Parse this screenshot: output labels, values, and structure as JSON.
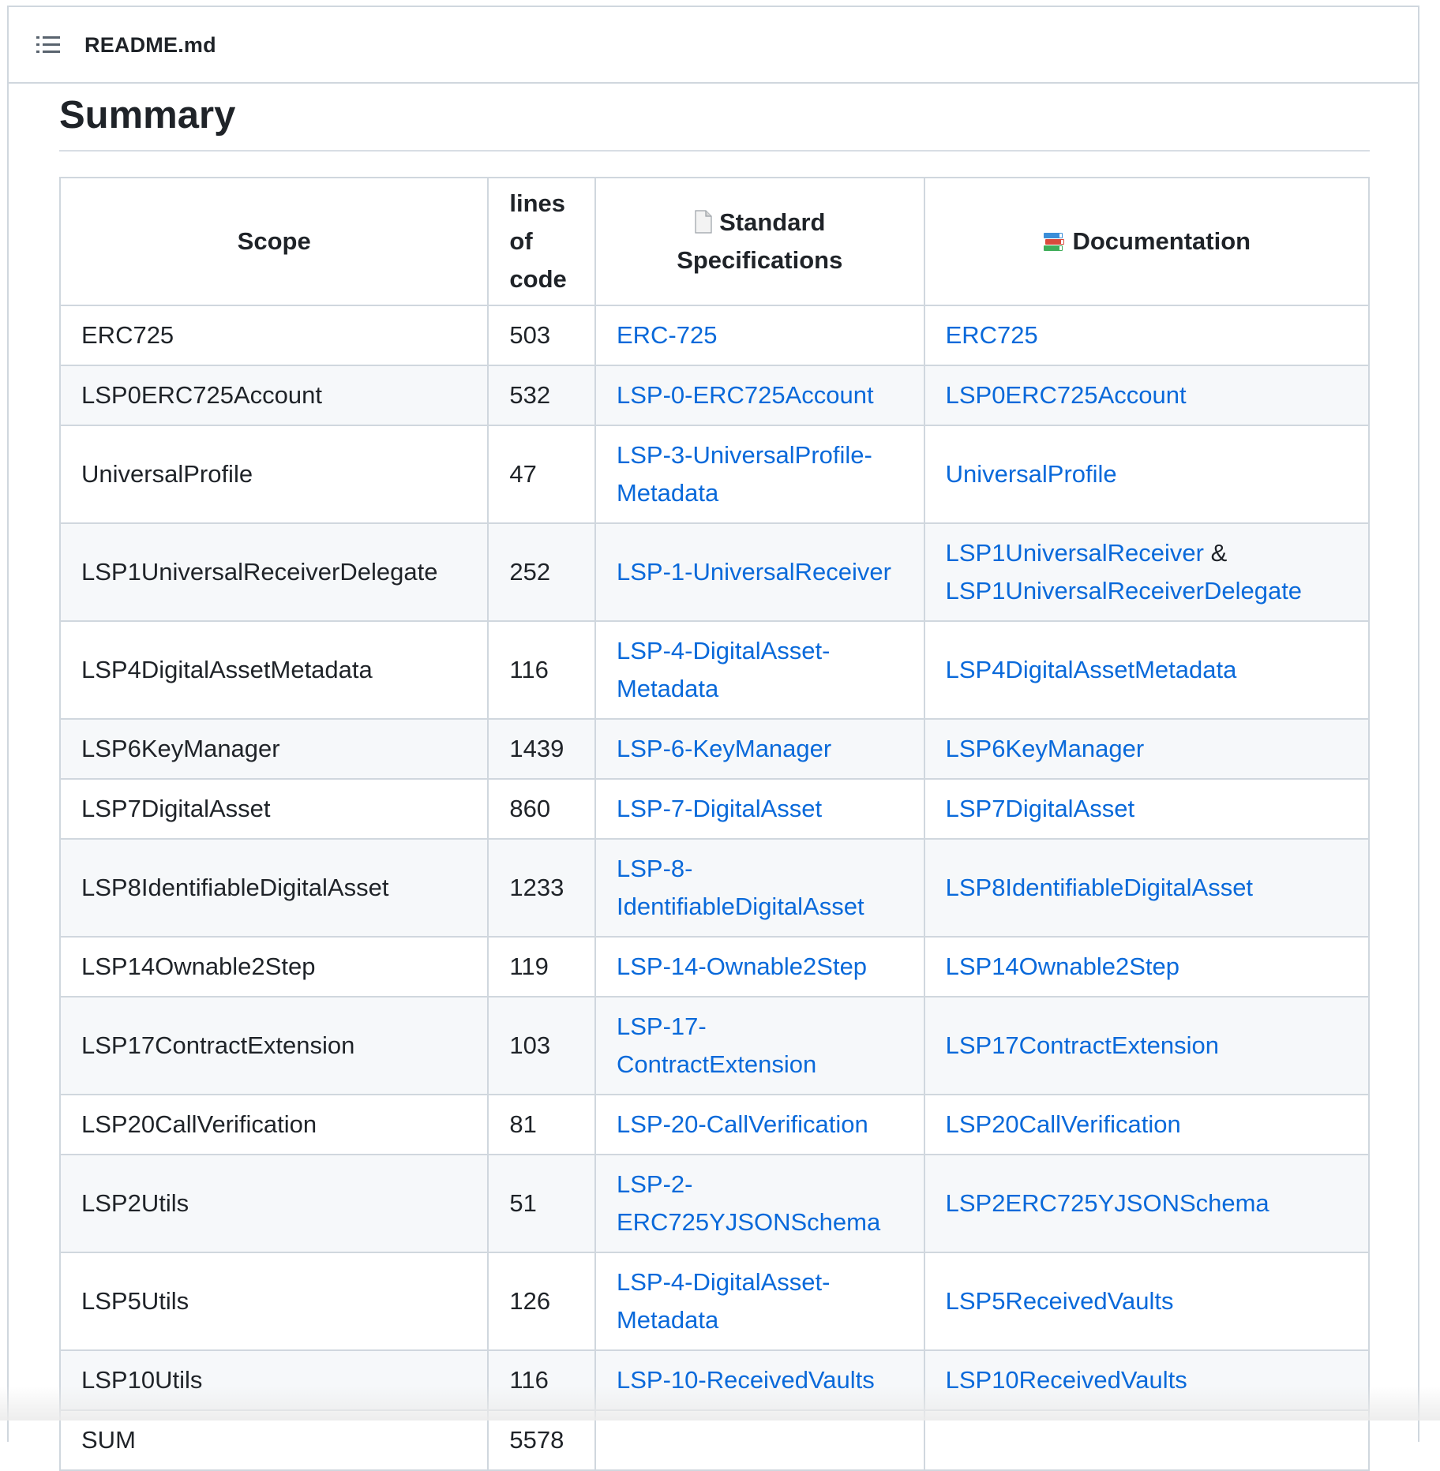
{
  "file_header": {
    "file_name": "README.md",
    "toc_icon": "list-icon"
  },
  "summary": {
    "heading": "Summary",
    "columns": {
      "scope": "Scope",
      "lines": "lines of code",
      "spec_icon": "page-facing-up-emoji",
      "spec": "Standard Specifications",
      "doc_icon": "books-emoji",
      "doc": "Documentation"
    },
    "rows": [
      {
        "scope": "ERC725",
        "lines": "503",
        "spec": "ERC-725",
        "doc": "ERC725",
        "doc_sep": "",
        "doc2": ""
      },
      {
        "scope": "LSP0ERC725Account",
        "lines": "532",
        "spec": "LSP-0-ERC725Account",
        "doc": "LSP0ERC725Account",
        "doc_sep": "",
        "doc2": ""
      },
      {
        "scope": "UniversalProfile",
        "lines": "47",
        "spec": "LSP-3-UniversalProfile-Metadata",
        "doc": "UniversalProfile",
        "doc_sep": "",
        "doc2": ""
      },
      {
        "scope": "LSP1UniversalReceiverDelegate",
        "lines": "252",
        "spec": "LSP-1-UniversalReceiver",
        "doc": "LSP1UniversalReceiver",
        "doc_sep": " & ",
        "doc2": "LSP1UniversalReceiverDelegate"
      },
      {
        "scope": "LSP4DigitalAssetMetadata",
        "lines": "116",
        "spec": "LSP-4-DigitalAsset-Metadata",
        "doc": "LSP4DigitalAssetMetadata",
        "doc_sep": "",
        "doc2": ""
      },
      {
        "scope": "LSP6KeyManager",
        "lines": "1439",
        "spec": "LSP-6-KeyManager",
        "doc": "LSP6KeyManager",
        "doc_sep": "",
        "doc2": ""
      },
      {
        "scope": "LSP7DigitalAsset",
        "lines": "860",
        "spec": "LSP-7-DigitalAsset",
        "doc": "LSP7DigitalAsset",
        "doc_sep": "",
        "doc2": ""
      },
      {
        "scope": "LSP8IdentifiableDigitalAsset",
        "lines": "1233",
        "spec": "LSP-8-IdentifiableDigitalAsset",
        "doc": "LSP8IdentifiableDigitalAsset",
        "doc_sep": "",
        "doc2": ""
      },
      {
        "scope": "LSP14Ownable2Step",
        "lines": "119",
        "spec": "LSP-14-Ownable2Step",
        "doc": "LSP14Ownable2Step",
        "doc_sep": "",
        "doc2": ""
      },
      {
        "scope": "LSP17ContractExtension",
        "lines": "103",
        "spec": "LSP-17-ContractExtension",
        "doc": "LSP17ContractExtension",
        "doc_sep": "",
        "doc2": ""
      },
      {
        "scope": "LSP20CallVerification",
        "lines": "81",
        "spec": "LSP-20-CallVerification",
        "doc": "LSP20CallVerification",
        "doc_sep": "",
        "doc2": ""
      },
      {
        "scope": "LSP2Utils",
        "lines": "51",
        "spec": "LSP-2-ERC725YJSONSchema",
        "doc": "LSP2ERC725YJSONSchema",
        "doc_sep": "",
        "doc2": ""
      },
      {
        "scope": "LSP5Utils",
        "lines": "126",
        "spec": "LSP-4-DigitalAsset-Metadata",
        "doc": "LSP5ReceivedVaults",
        "doc_sep": "",
        "doc2": ""
      },
      {
        "scope": "LSP10Utils",
        "lines": "116",
        "spec": "LSP-10-ReceivedVaults",
        "doc": "LSP10ReceivedVaults",
        "doc_sep": "",
        "doc2": ""
      },
      {
        "scope": "SUM",
        "lines": "5578",
        "spec": "",
        "doc": "",
        "doc_sep": "",
        "doc2": ""
      }
    ],
    "colors": {
      "link": "#0969da",
      "border": "#d0d7de",
      "stripe": "#f6f8fa",
      "text": "#1f2328"
    }
  }
}
